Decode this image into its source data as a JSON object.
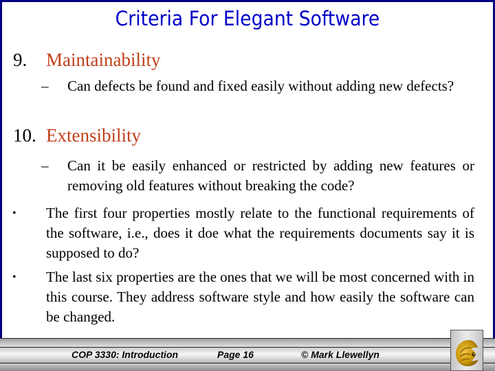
{
  "slide": {
    "title": "Criteria For Elegant Software",
    "colors": {
      "title": "#0000c8",
      "heading": "#c0401a",
      "border": "#000080"
    },
    "items": [
      {
        "number": "9.",
        "label": "Maintainability",
        "sub": {
          "marker": "–",
          "text": "Can defects be found and fixed easily without adding new defects?"
        }
      },
      {
        "number": "10.",
        "label": "Extensibility",
        "sub": {
          "marker": "–",
          "text": "Can it be easily enhanced or restricted by adding new features or removing old features without breaking the code?"
        }
      }
    ],
    "bullets": [
      {
        "marker": "•",
        "text": "The first four properties mostly relate to the functional requirements of the software, i.e., does it doe what the requirements documents say it is supposed to do?"
      },
      {
        "marker": "•",
        "text": "The last six properties are the ones that we will be most concerned with in this course.  They address software style and how easily the software can be changed."
      }
    ]
  },
  "footer": {
    "course": "COP 3330: Introduction",
    "page": "Page 16",
    "copyright": "© Mark Llewellyn",
    "logo_icon": "pegasus-logo-icon"
  }
}
